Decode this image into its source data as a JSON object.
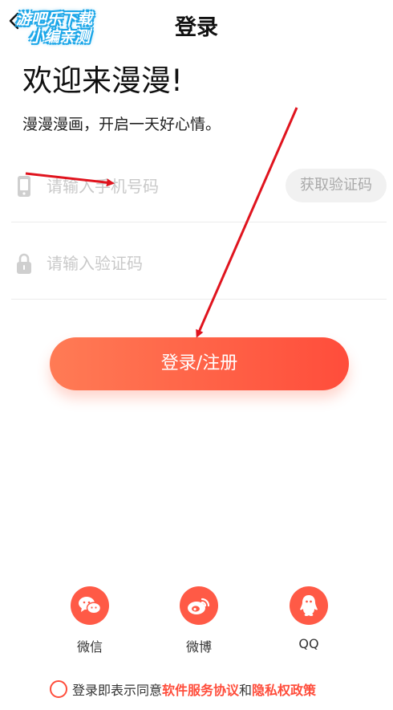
{
  "watermark": {
    "line1": "游吧乐下载",
    "line2": "小编亲测"
  },
  "header": {
    "title": "登录",
    "back_icon": "chevron-left-icon"
  },
  "welcome": {
    "title": "欢迎来漫漫!",
    "subtitle": "漫漫漫画，开启一天好心情。"
  },
  "form": {
    "phone": {
      "placeholder": "请输入手机号码",
      "icon": "phone-icon",
      "get_code_label": "获取验证码"
    },
    "code": {
      "placeholder": "请输入验证码",
      "icon": "lock-icon"
    },
    "submit_label": "登录/注册"
  },
  "social": [
    {
      "label": "微信",
      "icon": "wechat-icon"
    },
    {
      "label": "微博",
      "icon": "weibo-icon"
    },
    {
      "label": "QQ",
      "icon": "qq-icon"
    }
  ],
  "agreement": {
    "prefix": "登录即表示同意",
    "terms_link": "软件服务协议",
    "and": "和",
    "privacy_link": "隐私权政策"
  },
  "colors": {
    "accent": "#ff4d3b",
    "accent_light": "#ff7b55",
    "annotation_arrow": "#e0141e",
    "watermark": "#1aa6e8"
  }
}
